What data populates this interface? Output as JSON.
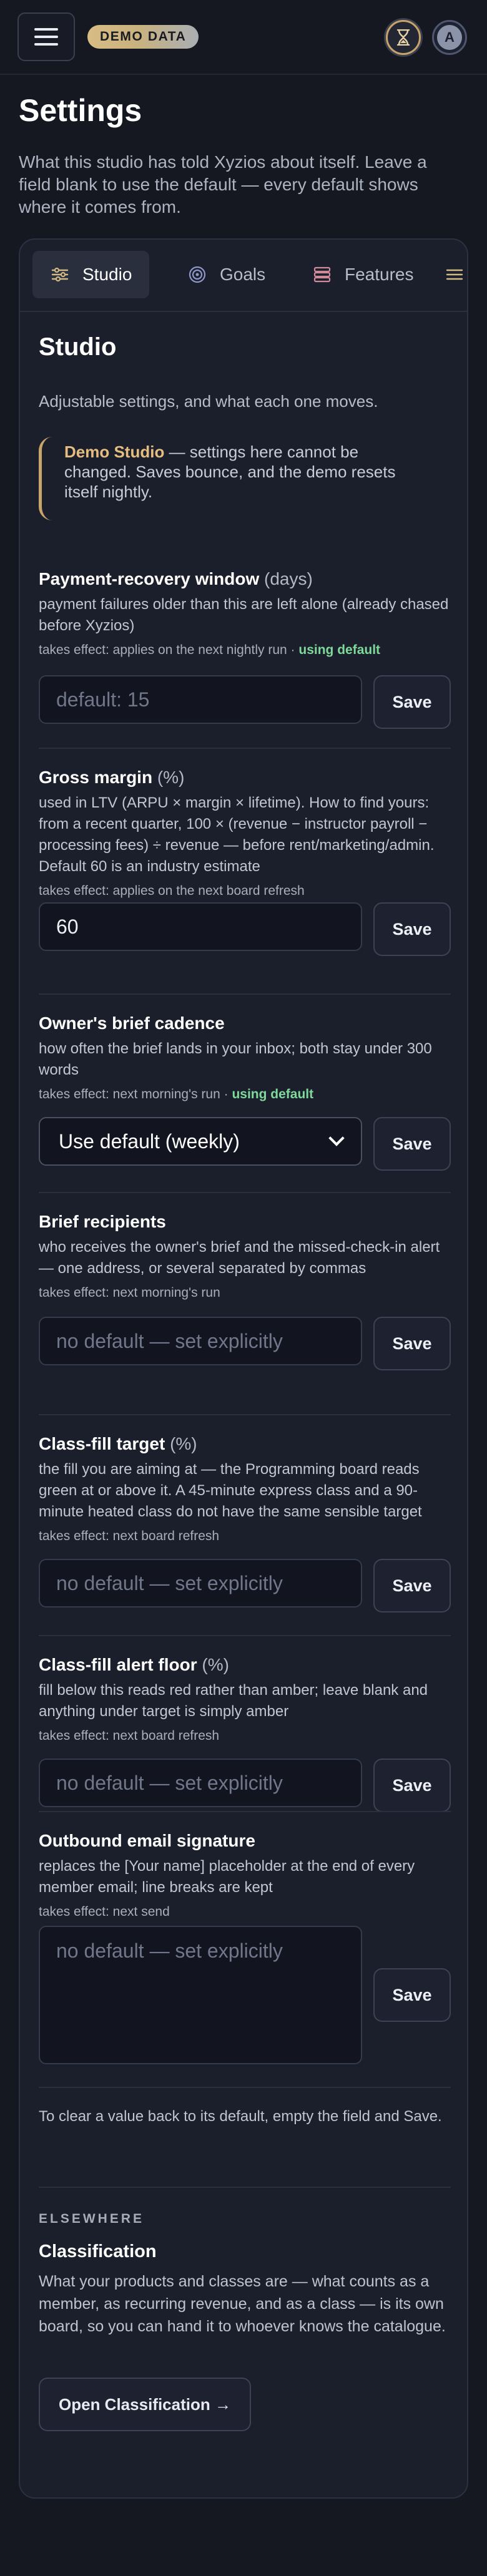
{
  "topbar": {
    "menu_icon": "hamburger-menu-icon",
    "badge": "DEMO DATA",
    "hourglass_icon": "hourglass-icon",
    "avatar_initial": "A",
    "accent": "#c9a46a"
  },
  "header": {
    "title": "Settings",
    "intro": "What this studio has told Xyzios about itself. Leave a field blank to use the default — every default shows where it comes from."
  },
  "tabs": [
    {
      "label": "Studio",
      "icon": "sliders-icon",
      "active": true
    },
    {
      "label": "Goals",
      "icon": "target-icon",
      "active": false
    },
    {
      "label": "Features",
      "icon": "stack-icon",
      "active": false
    }
  ],
  "section": {
    "title": "Studio",
    "subtitle": "Adjustable settings, and what each one moves."
  },
  "demo_note": {
    "name": "Demo Studio",
    "text": " — settings here cannot be changed. Saves bounce, and the demo resets itself nightly."
  },
  "fields": [
    {
      "label": "Payment-recovery window",
      "unit": "(days)",
      "desc": "payment failures older than this are left alone (already chased before Xyzios)",
      "effect": "takes effect: applies on the next nightly run · ",
      "flag": "using default",
      "value": "",
      "placeholder": "default: 15",
      "save": "Save"
    },
    {
      "label": "Gross margin",
      "unit": "(%)",
      "desc": "used in LTV (ARPU × margin × lifetime). How to find yours: from a recent quarter, 100 × (revenue − instructor payroll − processing fees) ÷ revenue — before rent/marketing/admin. Default 60 is an industry estimate",
      "effect": "takes effect: applies on the next board refresh",
      "flag": "",
      "value": "60",
      "placeholder": "",
      "save": "Save"
    },
    {
      "label": "Owner's brief cadence",
      "unit": "",
      "desc": "how often the brief lands in your inbox; both stay under 300 words",
      "effect": "takes effect: next morning's run · ",
      "flag": "using default",
      "value": "Use default (weekly)",
      "placeholder": "",
      "save": "Save"
    },
    {
      "label": "Brief recipients",
      "unit": "",
      "desc": "who receives the owner's brief and the missed-check-in alert — one address, or several separated by commas",
      "effect": "takes effect: next morning's run",
      "flag": "",
      "value": "",
      "placeholder": "no default — set explicitly",
      "save": "Save"
    },
    {
      "label": "Class-fill target",
      "unit": "(%)",
      "desc": "the fill you are aiming at — the Programming board reads green at or above it. A 45-minute express class and a 90-minute heated class do not have the same sensible target",
      "effect": "takes effect: next board refresh",
      "flag": "",
      "value": "",
      "placeholder": "no default — set explicitly",
      "save": "Save"
    },
    {
      "label": "Class-fill alert floor",
      "unit": "(%)",
      "desc": "fill below this reads red rather than amber; leave blank and anything under target is simply amber",
      "effect": "takes effect: next board refresh",
      "flag": "",
      "value": "",
      "placeholder": "no default — set explicitly",
      "save": "Save"
    },
    {
      "label": "Outbound email signature",
      "unit": "",
      "desc": "replaces the [Your name] placeholder at the end of every member email; line breaks are kept",
      "effect": "takes effect: next send",
      "flag": "",
      "value": "",
      "placeholder": "no default — set explicitly",
      "save": "Save"
    }
  ],
  "clear_note": "To clear a value back to its default, empty the field and Save.",
  "elsewhere": {
    "kicker": "ELSEWHERE",
    "title": "Classification",
    "desc": "What your products and classes are — what counts as a member, as recurring revenue, and as a class — is its own board, so you can hand it to whoever knows the catalogue.",
    "button": "Open Classification →"
  }
}
